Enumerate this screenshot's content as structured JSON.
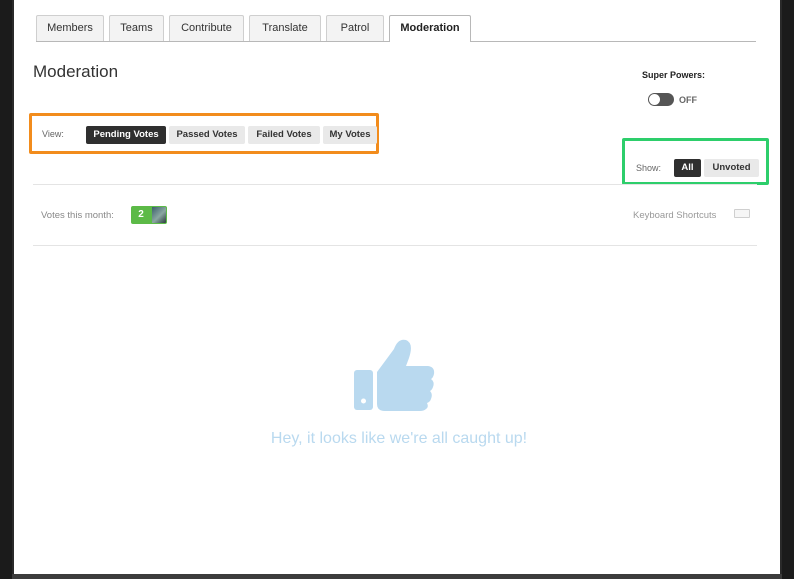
{
  "tabs": [
    {
      "label": "Members",
      "active": false
    },
    {
      "label": "Teams",
      "active": false
    },
    {
      "label": "Contribute",
      "active": false
    },
    {
      "label": "Translate",
      "active": false
    },
    {
      "label": "Patrol",
      "active": false
    },
    {
      "label": "Moderation",
      "active": true
    }
  ],
  "page": {
    "title": "Moderation"
  },
  "super_powers": {
    "label": "Super Powers:",
    "state": "OFF"
  },
  "view_filter": {
    "label": "View:",
    "options": [
      {
        "label": "Pending Votes",
        "active": true
      },
      {
        "label": "Passed Votes",
        "active": false
      },
      {
        "label": "Failed Votes",
        "active": false
      },
      {
        "label": "My Votes",
        "active": false
      }
    ],
    "highlight_color": "#f28c1c"
  },
  "show_filter": {
    "label": "Show:",
    "options": [
      {
        "label": "All",
        "active": true
      },
      {
        "label": "Unvoted",
        "active": false
      }
    ],
    "highlight_color": "#2dce6b"
  },
  "votes": {
    "label": "Votes this month:",
    "count": "2",
    "badge_color": "#5cba47"
  },
  "keyboard": {
    "label": "Keyboard Shortcuts",
    "icon": "keyboard-icon"
  },
  "empty_state": {
    "message": "Hey, it looks like we're all caught up!",
    "icon": "thumbs-up-icon",
    "color": "#b9d9ef"
  }
}
